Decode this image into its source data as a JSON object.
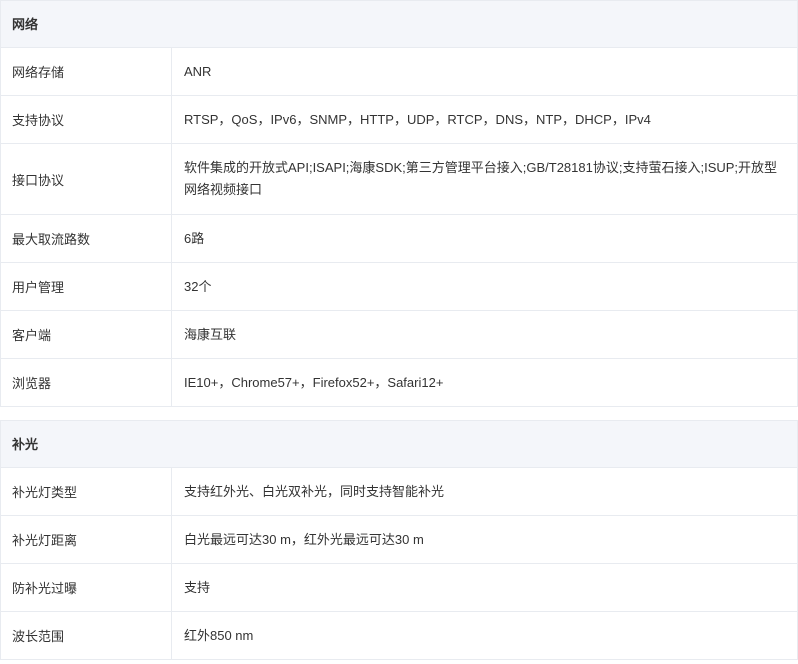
{
  "sections": [
    {
      "title": "网络",
      "rows": [
        {
          "label": "网络存储",
          "value": "ANR"
        },
        {
          "label": "支持协议",
          "value": "RTSP，QoS，IPv6，SNMP，HTTP，UDP，RTCP，DNS，NTP，DHCP，IPv4"
        },
        {
          "label": "接口协议",
          "value": "软件集成的开放式API;ISAPI;海康SDK;第三方管理平台接入;GB/T28181协议;支持萤石接入;ISUP;开放型网络视频接口"
        },
        {
          "label": "最大取流路数",
          "value": "6路"
        },
        {
          "label": "用户管理",
          "value": "32个"
        },
        {
          "label": "客户端",
          "value": "海康互联"
        },
        {
          "label": "浏览器",
          "value": "IE10+，Chrome57+，Firefox52+，Safari12+"
        }
      ]
    },
    {
      "title": "补光",
      "rows": [
        {
          "label": "补光灯类型",
          "value": "支持红外光、白光双补光，同时支持智能补光"
        },
        {
          "label": "补光灯距离",
          "value": "白光最远可达30 m，红外光最远可达30 m"
        },
        {
          "label": "防补光过曝",
          "value": "支持"
        },
        {
          "label": "波长范围",
          "value": "红外850 nm"
        }
      ]
    }
  ]
}
